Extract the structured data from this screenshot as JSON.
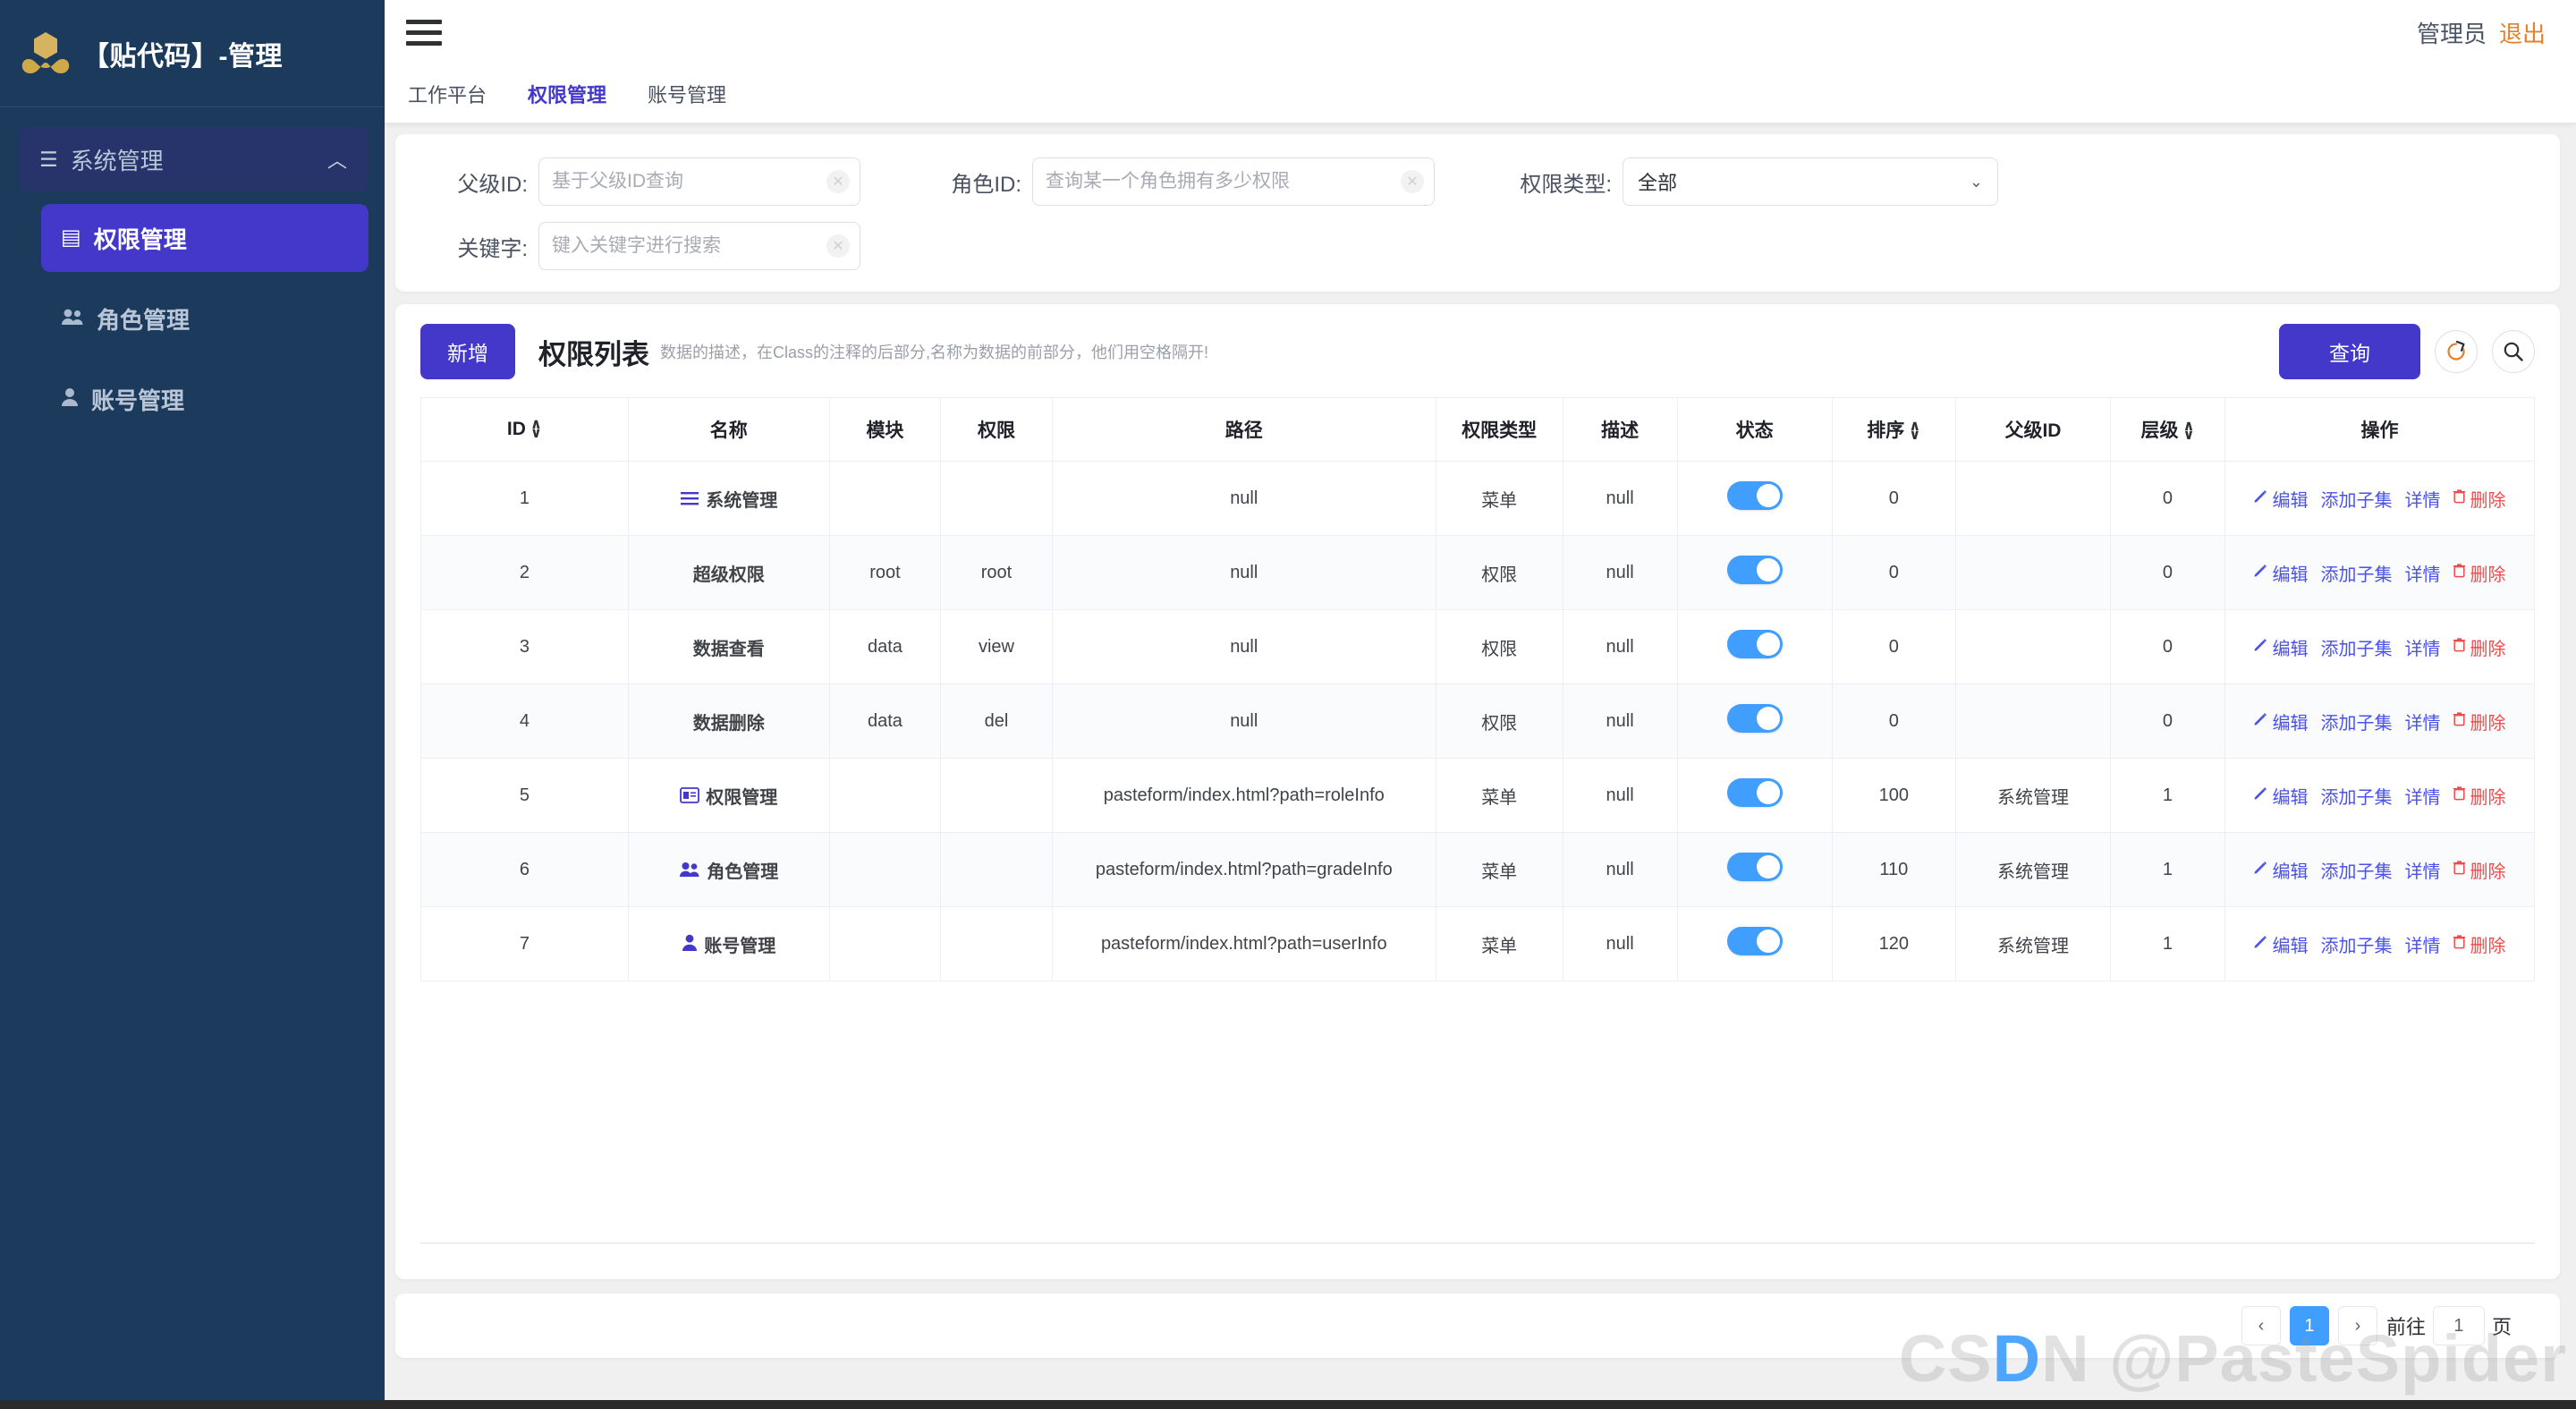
{
  "sidebar": {
    "logo_text": "【贴代码】-管理",
    "logo_icon": "brand-logo-icon",
    "group": {
      "icon": "menu-lines-icon",
      "label": "系统管理",
      "caret": "chevron-up-icon"
    },
    "items": [
      {
        "icon": "id-card-icon",
        "glyph": "▤",
        "label": "权限管理",
        "active": true
      },
      {
        "icon": "users-icon",
        "glyph": "👥",
        "label": "角色管理",
        "active": false
      },
      {
        "icon": "user-icon",
        "glyph": "👤",
        "label": "账号管理",
        "active": false
      }
    ]
  },
  "topbar": {
    "hamburger_icon": "hamburger-menu-icon",
    "user_name": "管理员",
    "logout_label": "退出",
    "logout_color": "#e6802a"
  },
  "tabs": [
    {
      "label": "工作平台",
      "active": false
    },
    {
      "label": "权限管理",
      "active": true
    },
    {
      "label": "账号管理",
      "active": false
    }
  ],
  "filters": {
    "parent_id": {
      "label": "父级ID:",
      "value": "",
      "placeholder": "基于父级ID查询",
      "clear_icon": "clear-circle-icon"
    },
    "role_id": {
      "label": "角色ID:",
      "value": "",
      "placeholder": "查询某一个角色拥有多少权限",
      "clear_icon": "clear-circle-icon"
    },
    "perm_type": {
      "label": "权限类型:",
      "value": "全部",
      "caret_icon": "chevron-down-icon",
      "options": [
        "全部"
      ]
    },
    "keyword": {
      "label": "关键字:",
      "value": "",
      "placeholder": "键入关键字进行搜索",
      "clear_icon": "clear-circle-icon"
    }
  },
  "toolbar": {
    "add_label": "新增",
    "title": "权限列表",
    "subtitle": "数据的描述，在Class的注释的后部分,名称为数据的前部分，他们用空格隔开!",
    "query_label": "查询",
    "refresh_icon": "refresh-icon",
    "search_icon": "search-icon",
    "primary_color": "#4338ca"
  },
  "table": {
    "columns": [
      {
        "key": "id",
        "label": "ID",
        "sortable": true
      },
      {
        "key": "name",
        "label": "名称",
        "sortable": false
      },
      {
        "key": "module",
        "label": "模块",
        "sortable": false
      },
      {
        "key": "perm",
        "label": "权限",
        "sortable": false
      },
      {
        "key": "path",
        "label": "路径",
        "sortable": false
      },
      {
        "key": "type",
        "label": "权限类型",
        "sortable": false
      },
      {
        "key": "desc",
        "label": "描述",
        "sortable": false
      },
      {
        "key": "status",
        "label": "状态",
        "sortable": false
      },
      {
        "key": "sort",
        "label": "排序",
        "sortable": true
      },
      {
        "key": "parent",
        "label": "父级ID",
        "sortable": false
      },
      {
        "key": "level",
        "label": "层级",
        "sortable": true
      },
      {
        "key": "ops",
        "label": "操作",
        "sortable": false
      }
    ],
    "sort_up_glyph": "∧",
    "sort_down_glyph": "∨",
    "rows": [
      {
        "id": "1",
        "name": "系统管理",
        "name_icon": "menu-lines-icon",
        "name_glyph": "☰",
        "name_color": "menu",
        "module": "",
        "perm": "",
        "path": "null",
        "type": "菜单",
        "desc": "null",
        "status": true,
        "sort": "0",
        "parent": "",
        "level": "0"
      },
      {
        "id": "2",
        "name": "超级权限",
        "name_icon": "",
        "name_glyph": "",
        "name_color": "perm",
        "module": "root",
        "perm": "root",
        "path": "null",
        "type": "权限",
        "desc": "null",
        "status": true,
        "sort": "0",
        "parent": "",
        "level": "0"
      },
      {
        "id": "3",
        "name": "数据查看",
        "name_icon": "",
        "name_glyph": "",
        "name_color": "perm",
        "module": "data",
        "perm": "view",
        "path": "null",
        "type": "权限",
        "desc": "null",
        "status": true,
        "sort": "0",
        "parent": "",
        "level": "0"
      },
      {
        "id": "4",
        "name": "数据删除",
        "name_icon": "",
        "name_glyph": "",
        "name_color": "perm",
        "module": "data",
        "perm": "del",
        "path": "null",
        "type": "权限",
        "desc": "null",
        "status": true,
        "sort": "0",
        "parent": "",
        "level": "0"
      },
      {
        "id": "5",
        "name": "权限管理",
        "name_icon": "id-card-icon",
        "name_glyph": "▤",
        "name_color": "menu",
        "module": "",
        "perm": "",
        "path": "pasteform/index.html?path=roleInfo",
        "type": "菜单",
        "desc": "null",
        "status": true,
        "sort": "100",
        "parent": "系统管理",
        "level": "1"
      },
      {
        "id": "6",
        "name": "角色管理",
        "name_icon": "users-icon",
        "name_glyph": "👥",
        "name_color": "menu",
        "module": "",
        "perm": "",
        "path": "pasteform/index.html?path=gradeInfo",
        "type": "菜单",
        "desc": "null",
        "status": true,
        "sort": "110",
        "parent": "系统管理",
        "level": "1"
      },
      {
        "id": "7",
        "name": "账号管理",
        "name_icon": "user-icon",
        "name_glyph": "👤",
        "name_color": "menu",
        "module": "",
        "perm": "",
        "path": "pasteform/index.html?path=userInfo",
        "type": "菜单",
        "desc": "null",
        "status": true,
        "sort": "120",
        "parent": "系统管理",
        "level": "1"
      }
    ],
    "row_actions": [
      {
        "label": "编辑",
        "icon": "pencil-icon",
        "glyph": "✎",
        "danger": false
      },
      {
        "label": "添加子集",
        "icon": "",
        "glyph": "",
        "danger": false
      },
      {
        "label": "详情",
        "icon": "",
        "glyph": "",
        "danger": false
      },
      {
        "label": "删除",
        "icon": "trash-icon",
        "glyph": "🗑",
        "danger": true
      }
    ]
  },
  "pagination": {
    "prev_glyph": "‹",
    "next_glyph": "›",
    "pages": [
      "1"
    ],
    "current_page": "1",
    "jump_prefix": "前往",
    "jump_value": "1",
    "jump_suffix": "页",
    "active_color": "#409eff"
  },
  "watermark": {
    "prefix": "CS",
    "highlight": "D",
    "suffix": "N  @PasteSpider"
  }
}
